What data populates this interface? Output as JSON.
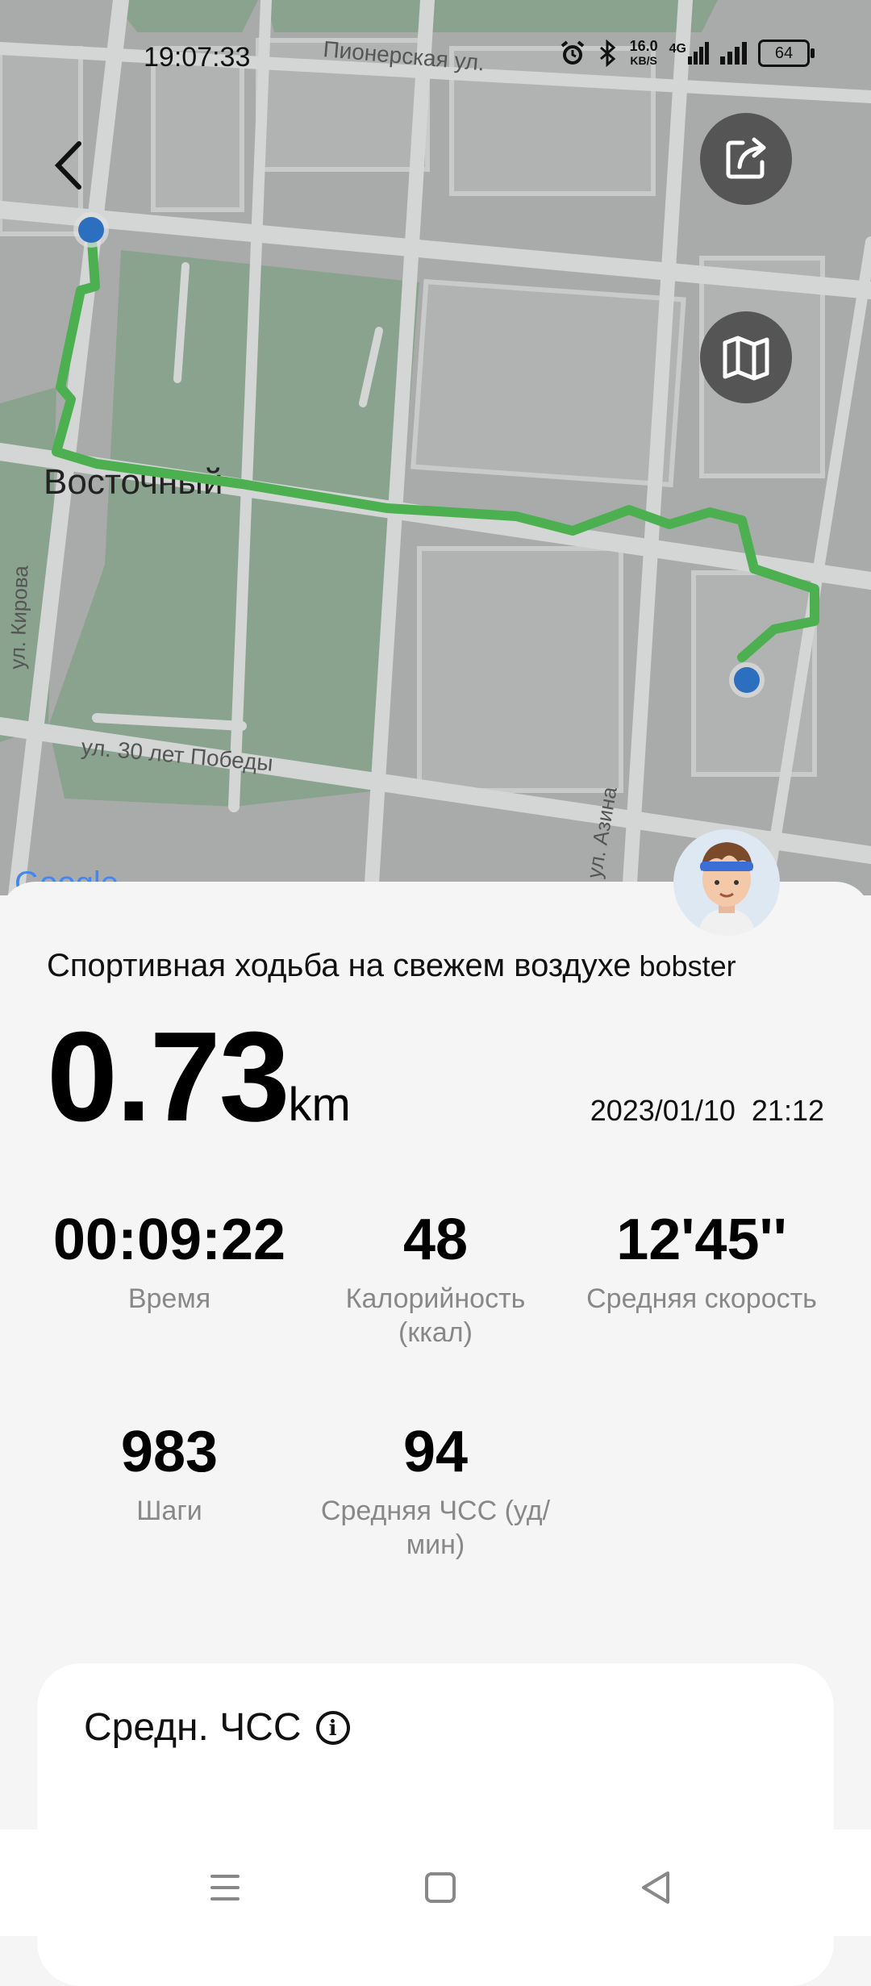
{
  "status_bar": {
    "time": "19:07:33",
    "net_speed": "16.0",
    "net_unit": "KB/S",
    "network": "4G",
    "battery": "64"
  },
  "map": {
    "streets": [
      "Пионерская ул.",
      "ул. Кирова",
      "ул. 30 лет Победы",
      "ул. Азина"
    ],
    "district": "Восточный",
    "route_color": "#4caf50",
    "attribution": "Google"
  },
  "workout": {
    "title": "Спортивная ходьба на свежем воздухе",
    "user": "bobster",
    "distance": "0.73",
    "distance_unit": "km",
    "date": "2023/01/10",
    "time": "21:12"
  },
  "stats": [
    {
      "value": "00:09:22",
      "label": "Время"
    },
    {
      "value": "48",
      "label": "Калорийность (ккал)"
    },
    {
      "value": "12'45''",
      "label": "Средняя скорость"
    },
    {
      "value": "983",
      "label": "Шаги"
    },
    {
      "value": "94",
      "label": "Средняя ЧСС (уд/мин)"
    }
  ],
  "hr_card": {
    "title": "Средн. ЧСС"
  },
  "colors": {
    "accent": "#4caf50",
    "marker": "#2d6fbf"
  }
}
